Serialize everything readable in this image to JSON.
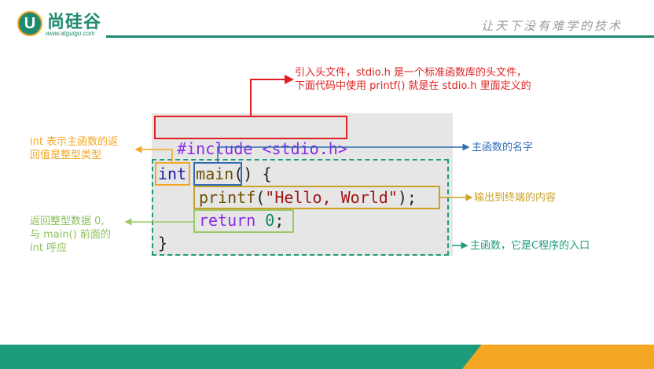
{
  "header": {
    "logo_letter": "U",
    "logo_name": "尚硅谷",
    "logo_url": "www.atguigu.com",
    "slogan": "让天下没有难学的技术"
  },
  "code": {
    "line1": "#include <stdio.h>",
    "line2_kw": "int",
    "line2_fn": "main",
    "line2_rest": "() {",
    "line3_fn": "printf",
    "line3_open": "(",
    "line3_str": "\"Hello, World\"",
    "line3_close": ");",
    "line4_kw": "return",
    "line4_num": "0",
    "line4_end": ";",
    "line5": "}"
  },
  "annotations": {
    "include_note_line1": "引入头文件，stdio.h 是一个标准函数库的头文件，",
    "include_note_line2": "下面代码中使用 printf() 就是在 stdio.h 里面定义的",
    "int_note_line1": "int 表示主函数的返",
    "int_note_line2": "回值是整型类型",
    "main_note": "主函数的名字",
    "printf_note": "输出到终端的内容",
    "return_note_line1": "返回整型数据 0,",
    "return_note_line2": "与 main() 前面的",
    "return_note_line3": "int 呼应",
    "body_note": "主函数，它是C程序的入口"
  },
  "colors": {
    "brand_green": "#1e9b7a",
    "brand_orange": "#f5a623",
    "red": "#e02020",
    "blue": "#2e6db4",
    "gold": "#c9a227",
    "light_green": "#9bc96a"
  }
}
